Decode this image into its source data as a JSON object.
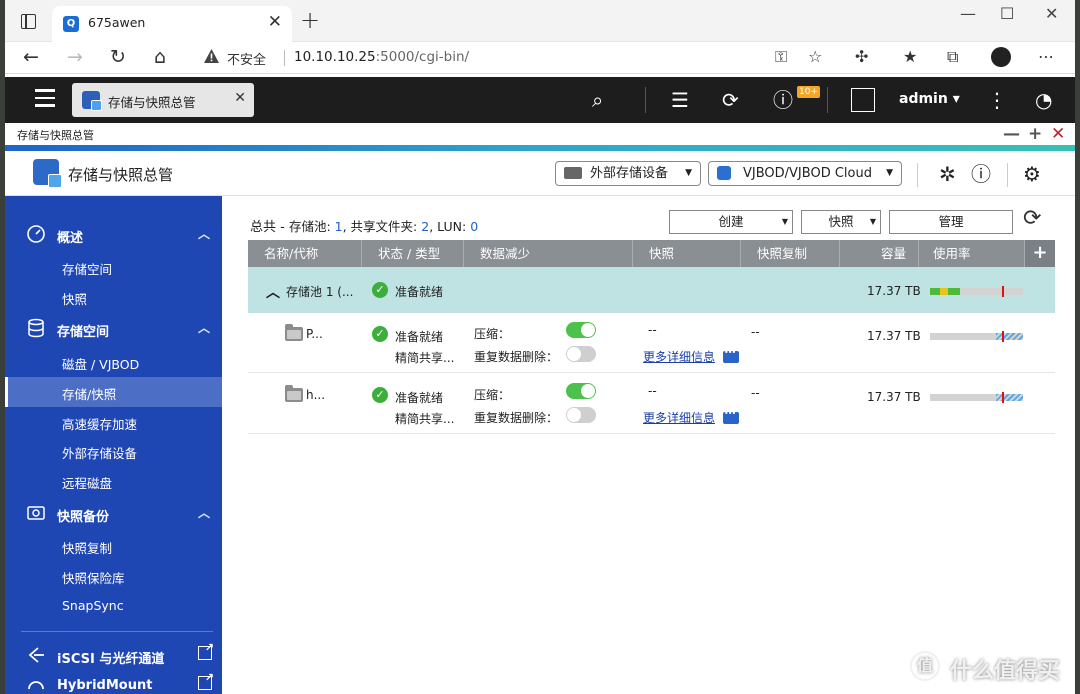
{
  "browser": {
    "tab_title": "675awen",
    "tab_favicon_letter": "Q",
    "insecure_label": "不安全",
    "url_host": "10.10.10.25",
    "url_rest": ":5000/cgi-bin/"
  },
  "qts": {
    "app_tab_title": "存储与快照总管",
    "notification_badge": "10+",
    "username": "admin"
  },
  "app": {
    "window_title": "存储与快照总管",
    "name": "存储与快照总管",
    "external_device_dropdown": "外部存储设备",
    "vjbod_dropdown": "VJBOD/VJBOD Cloud"
  },
  "sidebar": {
    "groups": [
      {
        "label": "概述",
        "items": [
          "存储空间",
          "快照"
        ]
      },
      {
        "label": "存储空间",
        "items": [
          "磁盘 / VJBOD",
          "存储/快照",
          "高速缓存加速",
          "外部存储设备",
          "远程磁盘"
        ]
      },
      {
        "label": "快照备份",
        "items": [
          "快照复制",
          "快照保险库",
          "SnapSync"
        ]
      },
      {
        "label": "iSCSI 与光纤通道"
      },
      {
        "label": "HybridMount"
      }
    ],
    "active_item": "存储/快照"
  },
  "summary": {
    "lead": "总共 - ",
    "pool_label": "存储池: ",
    "pool_count": "1",
    "share_label": ", 共享文件夹: ",
    "share_count": "2",
    "lun_label": ", LUN: ",
    "lun_count": "0"
  },
  "actions": {
    "create": "创建",
    "snapshot": "快照",
    "manage": "管理"
  },
  "table": {
    "headers": [
      "名称/代称",
      "状态 / 类型",
      "数据减少",
      "快照",
      "快照复制",
      "容量",
      "使用率"
    ],
    "pool": {
      "name": "存储池 1 (...",
      "status": "准备就绪",
      "capacity": "17.37 TB"
    },
    "volumes": [
      {
        "name": "P...",
        "status": "准备就绪",
        "type": "精简共享...",
        "compress_label": "压缩：",
        "dedupe_label": "重复数据删除：",
        "compress_on": true,
        "dedupe_on": false,
        "snapshot": "--",
        "replication": "--",
        "more": "更多详细信息",
        "capacity": "17.37 TB"
      },
      {
        "name": "h...",
        "status": "准备就绪",
        "type": "精简共享...",
        "compress_label": "压缩：",
        "dedupe_label": "重复数据删除：",
        "compress_on": true,
        "dedupe_on": false,
        "snapshot": "--",
        "replication": "--",
        "more": "更多详细信息",
        "capacity": "17.37 TB"
      }
    ]
  },
  "colors": {
    "sidebar_bg": "#1f47b4",
    "pool_row_bg": "#bfe3e2",
    "status_ok": "#3cae3c",
    "toggle_on": "#4cc14c",
    "link": "#1a3fa8"
  },
  "watermark": {
    "logo_text": "值",
    "text": "什么值得买"
  }
}
